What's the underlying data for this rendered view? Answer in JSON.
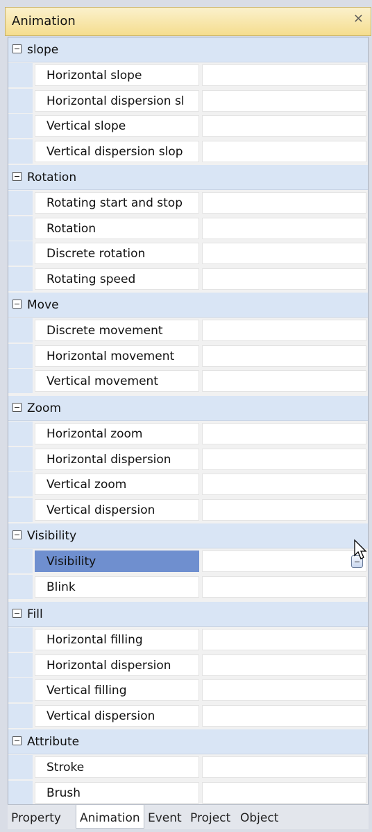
{
  "panel": {
    "title": "Animation",
    "close_glyph": "×"
  },
  "categories": [
    {
      "label": "slope",
      "items": [
        "Horizontal slope",
        "Horizontal dispersion sl",
        "Vertical slope",
        "Vertical dispersion slop"
      ]
    },
    {
      "label": "Rotation",
      "items": [
        "Rotating start and stop",
        "Rotation",
        "Discrete rotation",
        "Rotating speed"
      ]
    },
    {
      "label": "Move",
      "items": [
        "Discrete movement",
        "Horizontal movement",
        "Vertical movement"
      ]
    },
    {
      "label": "Zoom",
      "items": [
        "Horizontal zoom",
        "Horizontal dispersion",
        "Vertical zoom",
        "Vertical dispersion"
      ]
    },
    {
      "label": "Visibility",
      "items": [
        "Visibility",
        "Blink"
      ]
    },
    {
      "label": "Fill",
      "items": [
        "Horizontal filling",
        "Horizontal dispersion",
        "Vertical filling",
        "Vertical dispersion"
      ]
    },
    {
      "label": "Attribute",
      "items": [
        "Stroke",
        "Brush"
      ]
    }
  ],
  "selected_property": "Visibility",
  "tabs": [
    {
      "label": "Property",
      "active": false
    },
    {
      "label": "Animation",
      "active": true
    },
    {
      "label": "Event",
      "active": false
    },
    {
      "label": "Project",
      "active": false
    },
    {
      "label": "Object",
      "active": false
    }
  ],
  "colors": {
    "title_bar": "#f5dd8e",
    "category_bg": "#d9e5f5",
    "selected_row": "#6f8fcf"
  },
  "icons": {
    "collapse": "collapse-minus-icon",
    "close": "close-icon",
    "ellipsis": "ellipsis-button-icon",
    "cursor": "mouse-pointer-icon"
  }
}
